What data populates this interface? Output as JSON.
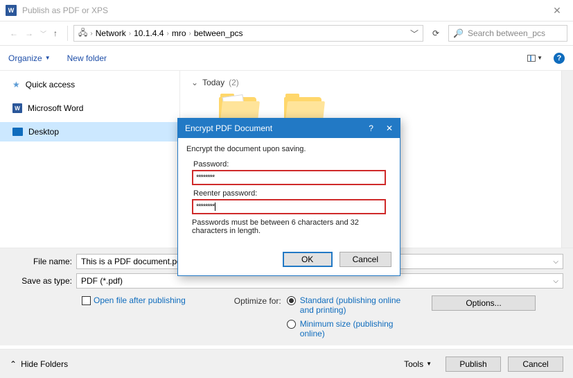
{
  "window": {
    "title": "Publish as PDF or XPS"
  },
  "breadcrumb": {
    "root_icon": "network",
    "items": [
      "Network",
      "10.1.4.4",
      "mro",
      "between_pcs"
    ]
  },
  "search": {
    "placeholder": "Search between_pcs"
  },
  "toolbar": {
    "organize": "Organize",
    "new_folder": "New folder"
  },
  "sidebar": {
    "items": [
      {
        "label": "Quick access",
        "icon": "star"
      },
      {
        "label": "Microsoft Word",
        "icon": "word"
      },
      {
        "label": "Desktop",
        "icon": "desktop",
        "selected": true
      }
    ]
  },
  "content": {
    "group_label": "Today",
    "group_count": "(2)"
  },
  "fields": {
    "filename_label": "File name:",
    "filename_value": "This is a PDF document.pdf",
    "savetype_label": "Save as type:",
    "savetype_value": "PDF (*.pdf)"
  },
  "options": {
    "open_after_label": "Open file after publishing",
    "optimize_label": "Optimize for:",
    "radio_standard": "Standard (publishing online and printing)",
    "radio_minimum": "Minimum size (publishing online)",
    "options_button": "Options..."
  },
  "footer": {
    "hide_folders": "Hide Folders",
    "tools": "Tools",
    "publish": "Publish",
    "cancel": "Cancel"
  },
  "modal": {
    "title": "Encrypt PDF Document",
    "intro": "Encrypt the document upon saving.",
    "password_label": "Password:",
    "password_value": "********",
    "reenter_label": "Reenter password:",
    "reenter_value": "********",
    "hint": "Passwords must be between 6 characters and 32 characters in length.",
    "ok": "OK",
    "cancel": "Cancel"
  }
}
